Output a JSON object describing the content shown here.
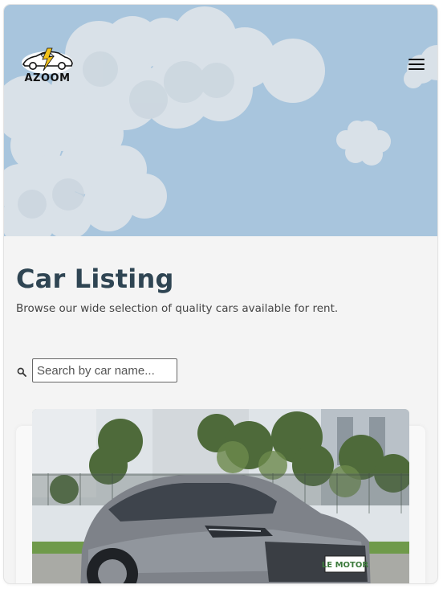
{
  "brand": {
    "logo_text": "AZOOM"
  },
  "header": {
    "menu_icon": "hamburger-menu-icon"
  },
  "page": {
    "title": "Car Listing",
    "subtitle": "Browse our wide selection of quality cars available for rent."
  },
  "search": {
    "icon": "search-icon",
    "placeholder": "Search by car name...",
    "value": ""
  },
  "listing": {
    "cards": [
      {
        "plate_text": "LE MOTOR"
      }
    ]
  },
  "colors": {
    "hero_sky": "#a8c5dd",
    "cloud": "#d9e1e8",
    "title": "#2f4553",
    "page_bg": "#f4f4f4"
  }
}
